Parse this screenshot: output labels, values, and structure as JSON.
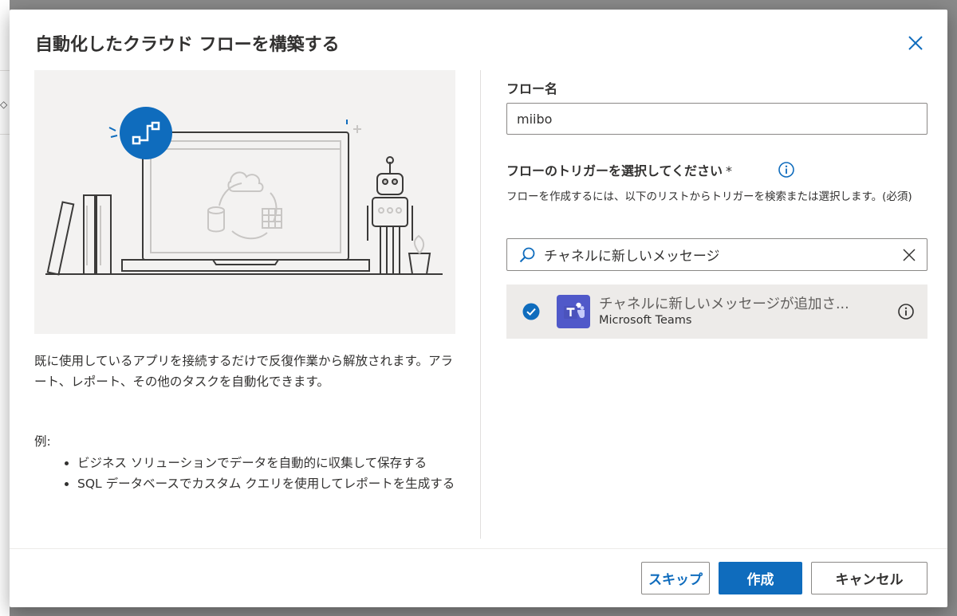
{
  "dialog": {
    "title": "自動化したクラウド フローを構築する",
    "description": "既に使用しているアプリを接続するだけで反復作業から解放されます。アラート、レポート、その他のタスクを自動化できます。",
    "example_label": "例:",
    "examples": [
      "ビジネス ソリューションでデータを自動的に収集して保存する",
      "SQL データベースでカスタム クエリを使用してレポートを生成する"
    ]
  },
  "form": {
    "flow_name_label": "フロー名",
    "flow_name_value": "miibo",
    "trigger_label": "フローのトリガーを選択してください",
    "required_mark": "*",
    "helper_text": "フローを作成するには、以下のリストからトリガーを検索または選択します。(必須)",
    "search_value": "チャネルに新しいメッセージ",
    "selected_trigger": {
      "name": "チャネルに新しいメッセージが追加さ...",
      "connector": "Microsoft Teams",
      "icon": "microsoft-teams-icon",
      "selected": true
    }
  },
  "buttons": {
    "skip": "スキップ",
    "create": "作成",
    "cancel": "キャンセル"
  },
  "colors": {
    "accent": "#0f6cbd",
    "teams": "#5059c9",
    "illustration_bg": "#f3f2f1",
    "selected_row_bg": "#edebe9"
  }
}
